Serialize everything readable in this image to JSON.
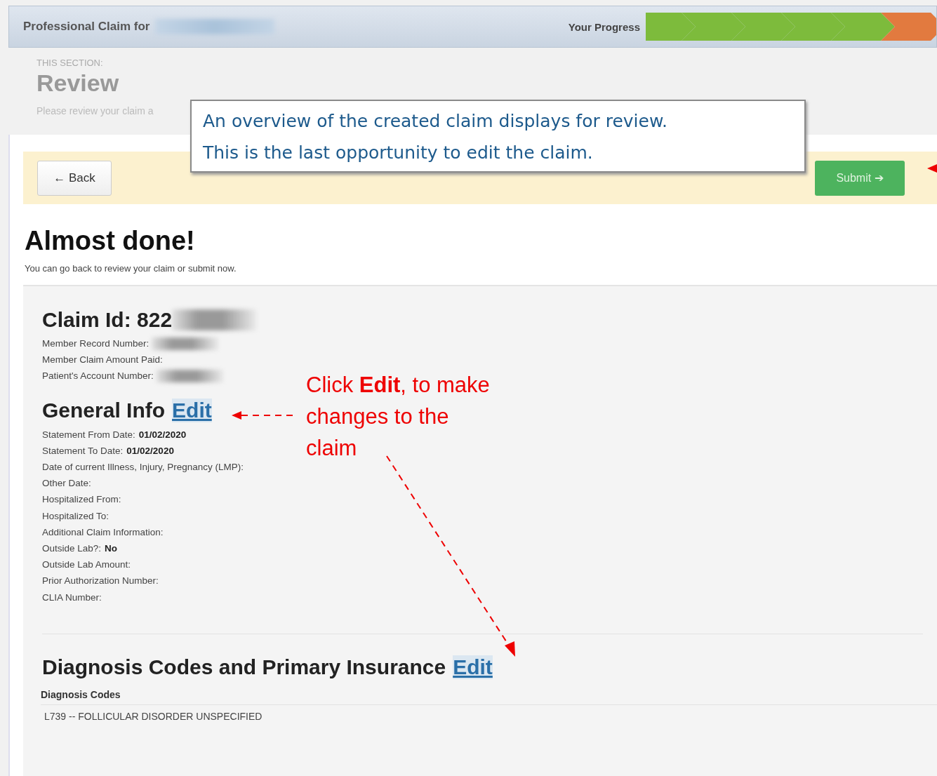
{
  "header": {
    "title": "Professional Claim for",
    "progress_label": "Your Progress",
    "steps": [
      {
        "color": "#7dbb3c"
      },
      {
        "color": "#7dbb3c"
      },
      {
        "color": "#7dbb3c"
      },
      {
        "color": "#7dbb3c"
      },
      {
        "color": "#7dbb3c"
      },
      {
        "color": "#e27a3f"
      }
    ]
  },
  "section": {
    "eyebrow": "THIS SECTION:",
    "title": "Review",
    "subtitle": "Please review your claim a"
  },
  "actions": {
    "back": "← Back",
    "submit": "Submit ➔"
  },
  "heading": "Almost done!",
  "intro": "You can go back to review your claim or submit now.",
  "claim": {
    "title": "Claim Id: 822",
    "fields": [
      {
        "label": "Member Record Number:",
        "redacted": true
      },
      {
        "label": "Member Claim Amount Paid:",
        "redacted": false
      },
      {
        "label": "Patient's Account Number:",
        "redacted": true
      }
    ]
  },
  "general_info": {
    "title": "General Info",
    "edit": "Edit",
    "fields": [
      {
        "label": "Statement From Date:",
        "value": "01/02/2020"
      },
      {
        "label": "Statement To Date:",
        "value": "01/02/2020"
      },
      {
        "label": "Date of current Illness, Injury, Pregnancy (LMP):"
      },
      {
        "label": "Other Date:"
      },
      {
        "label": "Hospitalized From:"
      },
      {
        "label": "Hospitalized To:"
      },
      {
        "label": "Additional Claim Information:"
      },
      {
        "label": "Outside Lab?:",
        "value": "No"
      },
      {
        "label": "Outside Lab Amount:"
      },
      {
        "label": "Prior Authorization Number:"
      },
      {
        "label": "CLIA Number:"
      }
    ]
  },
  "diagnosis": {
    "title": "Diagnosis Codes and Primary Insurance",
    "edit": "Edit",
    "codes_label": "Diagnosis Codes",
    "codes": [
      "L739 -- FOLLICULAR DISORDER UNSPECIFIED"
    ]
  },
  "callout": [
    "An overview of the created claim displays for review.",
    "This is the last opportunity to edit the claim."
  ],
  "annotation": "Click **Edit**, to make changes to the claim"
}
